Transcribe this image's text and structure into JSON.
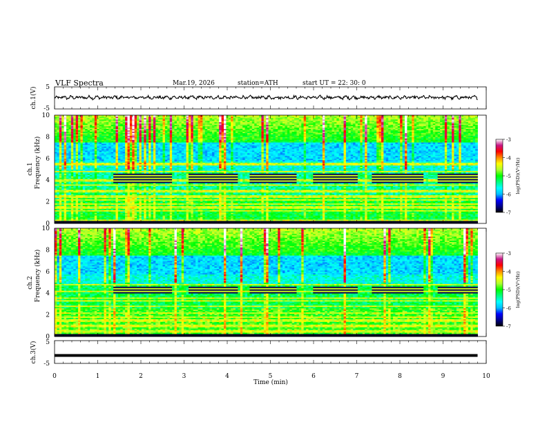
{
  "header": {
    "title": "VLF  Spectra",
    "date": "Mar.19, 2026",
    "station": "station=ATH",
    "start": "start  UT  =    22: 30: 0"
  },
  "colorbar": {
    "label": "log(PSD)(V²/Hz)",
    "ticks": [
      "-3",
      "-4",
      "-5",
      "-6",
      "-7"
    ],
    "colors": [
      "#000000",
      "#00008b",
      "#0000ff",
      "#00bfff",
      "#00ffff",
      "#00ff7f",
      "#00ff00",
      "#adff2f",
      "#ffff00",
      "#ff8c00",
      "#ff0000",
      "#c71585",
      "#ffffff"
    ]
  },
  "chart_data": [
    {
      "type": "line",
      "id": "ch1",
      "ylabel": "ch.1(V)",
      "ylim": [
        -5,
        5
      ],
      "yticks": [
        "5",
        "-5"
      ],
      "x_range_min": [
        0,
        9.8
      ],
      "description_values": "quasi-random waveform near +0.2 V, amplitude about 1 V",
      "mean": 0.2
    },
    {
      "type": "heatmap",
      "id": "ch1-spectrogram",
      "ylabel_top": "ch.1",
      "ylabel": "Frequency (kHz)",
      "ylim": [
        0,
        10
      ],
      "yticks": [
        "0",
        "2",
        "4",
        "6",
        "8",
        "10"
      ],
      "x_range_min": [
        0,
        9.8
      ],
      "persistent_lines_khz": [
        0.1,
        0.3,
        1.2,
        1.5,
        1.8,
        2.2,
        2.5,
        3.0,
        3.6,
        4.0,
        4.8,
        5.5
      ],
      "pulsed_band_khz": [
        3.8,
        4.6
      ],
      "pulse_on_intervals_min": [
        [
          1.35,
          2.7
        ],
        [
          3.1,
          4.2
        ],
        [
          4.5,
          5.6
        ],
        [
          5.95,
          7.0
        ],
        [
          7.35,
          8.5
        ],
        [
          8.85,
          9.8
        ]
      ]
    },
    {
      "type": "heatmap",
      "id": "ch2-spectrogram",
      "ylabel_top": "ch.2",
      "ylabel": "Frequency (kHz)",
      "ylim": [
        0,
        10
      ],
      "yticks": [
        "0",
        "2",
        "4",
        "6",
        "8",
        "10"
      ],
      "x_range_min": [
        0,
        9.8
      ],
      "persistent_lines_khz": [
        0.1,
        0.5,
        1.0,
        1.5,
        1.8,
        2.2,
        2.8,
        3.3,
        3.6,
        4.2,
        4.8
      ],
      "pulsed_band_khz": [
        4.0,
        4.6
      ],
      "pulse_on_intervals_min": [
        [
          1.35,
          2.7
        ],
        [
          3.1,
          4.2
        ],
        [
          4.5,
          5.6
        ],
        [
          5.95,
          7.0
        ],
        [
          7.35,
          8.5
        ],
        [
          8.85,
          9.8
        ]
      ]
    },
    {
      "type": "line",
      "id": "ch3",
      "ylabel": "ch.3(V)",
      "ylim": [
        -5,
        5
      ],
      "yticks": [
        "5",
        "0",
        "-5"
      ],
      "x_range_min": [
        0,
        9.8
      ],
      "constant_value": -1.5
    }
  ],
  "xaxis": {
    "label": "Time  (min)",
    "xlim": [
      0,
      10
    ],
    "ticks": [
      "0",
      "1",
      "2",
      "3",
      "4",
      "5",
      "6",
      "7",
      "8",
      "9",
      "10"
    ]
  }
}
